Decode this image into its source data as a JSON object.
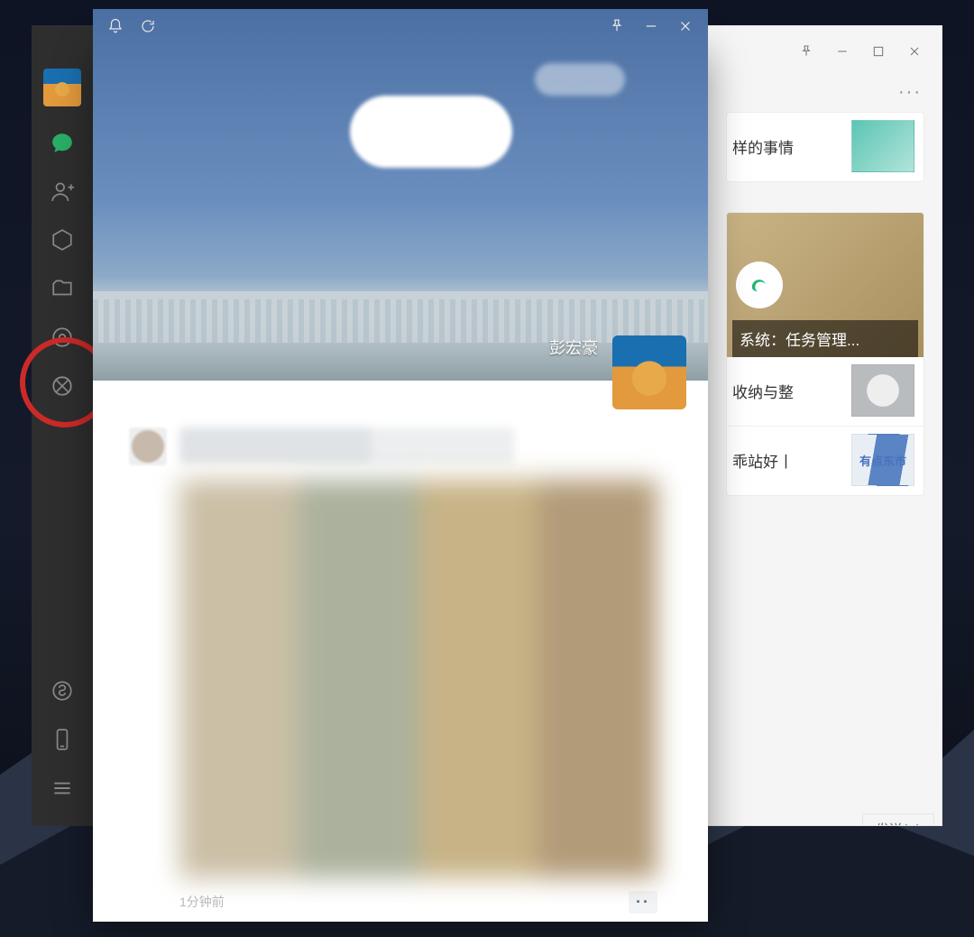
{
  "sidebar": {
    "icons": [
      "chat",
      "contacts",
      "favorites",
      "files",
      "browse",
      "moments"
    ],
    "bottom_icons": [
      "miniprogram",
      "phone",
      "menu"
    ]
  },
  "main_window": {
    "titlebar": [
      "pin",
      "minimize",
      "maximize",
      "close"
    ],
    "more_label": "···"
  },
  "articles": [
    {
      "title_fragment": "样的事情"
    },
    {
      "caption": "系统：任务管理...",
      "has_image": true
    },
    {
      "title_fragment": "收纳与整"
    },
    {
      "title_fragment": "乖站好丨",
      "thumb_text": "有点东市"
    }
  ],
  "send_button": "发送(S)",
  "moments_window": {
    "top_icons_left": [
      "bell",
      "refresh"
    ],
    "top_icons_right": [
      "pin",
      "minimize",
      "close"
    ],
    "cover_name": "彭宏豪",
    "post_time": "1分钟前",
    "post_more": "··"
  }
}
